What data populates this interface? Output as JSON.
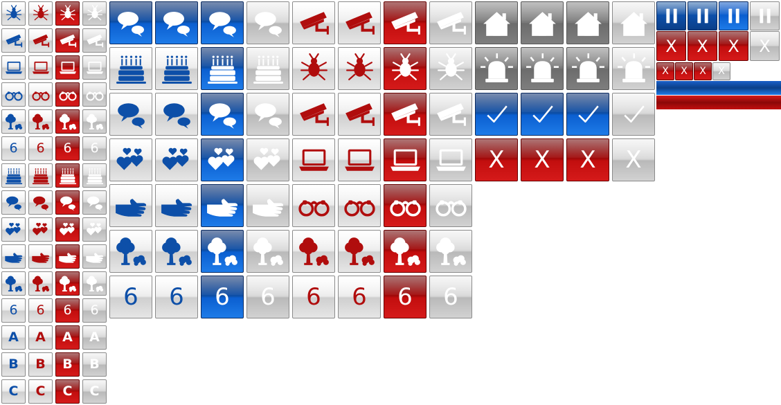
{
  "colors": {
    "blue": "#0d4fa8",
    "red": "#b00d0d",
    "light_gray": "#c9c9c9",
    "white": "#ffffff",
    "dark_gray": "#7a7a7a"
  },
  "small_grid": {
    "rows": [
      {
        "icon": "bug-icon"
      },
      {
        "icon": "security-camera-icon"
      },
      {
        "icon": "laptop-icon"
      },
      {
        "icon": "binoculars-icon"
      },
      {
        "icon": "tree-icon"
      },
      {
        "icon": "digit-icon",
        "text": "6"
      },
      {
        "icon": "birthday-cake-icon"
      },
      {
        "icon": "speech-bubbles-icon"
      },
      {
        "icon": "hearts-icon"
      },
      {
        "icon": "hand-icon"
      },
      {
        "icon": "tree-icon"
      },
      {
        "icon": "digit-icon",
        "text": "6"
      },
      {
        "icon": "letter-icon",
        "text": "A"
      },
      {
        "icon": "letter-icon",
        "text": "B"
      },
      {
        "icon": "letter-icon",
        "text": "C"
      }
    ],
    "variants": [
      "blue-fg",
      "red-fg",
      "red-bg",
      "gray-fg"
    ]
  },
  "large_grid": {
    "rows": [
      {
        "groups": [
          "speech-bubbles-icon",
          "security-camera-icon",
          "house-icon"
        ]
      },
      {
        "groups": [
          "birthday-cake-icon",
          "bug-icon",
          "siren-icon"
        ]
      },
      {
        "groups": [
          "speech-bubbles-icon",
          "security-camera-icon",
          "checkmark-icon"
        ]
      },
      {
        "groups": [
          "hearts-icon",
          "laptop-icon",
          "x-icon"
        ]
      },
      {
        "groups": [
          "hand-icon",
          "binoculars-icon"
        ]
      },
      {
        "groups": [
          "tree-icon",
          "tree-icon"
        ]
      },
      {
        "groups": [
          "digit-icon",
          "digit-icon"
        ],
        "text": "6"
      }
    ]
  },
  "texts": {
    "x_mark": "X",
    "digit": "6",
    "check": "✓"
  },
  "small_buttons": {
    "pause": [
      "pause-icon",
      "pause-icon",
      "pause-icon",
      "pause-icon"
    ],
    "close": [
      "x-icon",
      "x-icon",
      "x-icon",
      "x-icon"
    ],
    "mini_close": [
      "x-icon",
      "x-icon",
      "x-icon",
      "x-icon"
    ]
  },
  "bars": [
    "blue-bar",
    "red-bar"
  ]
}
